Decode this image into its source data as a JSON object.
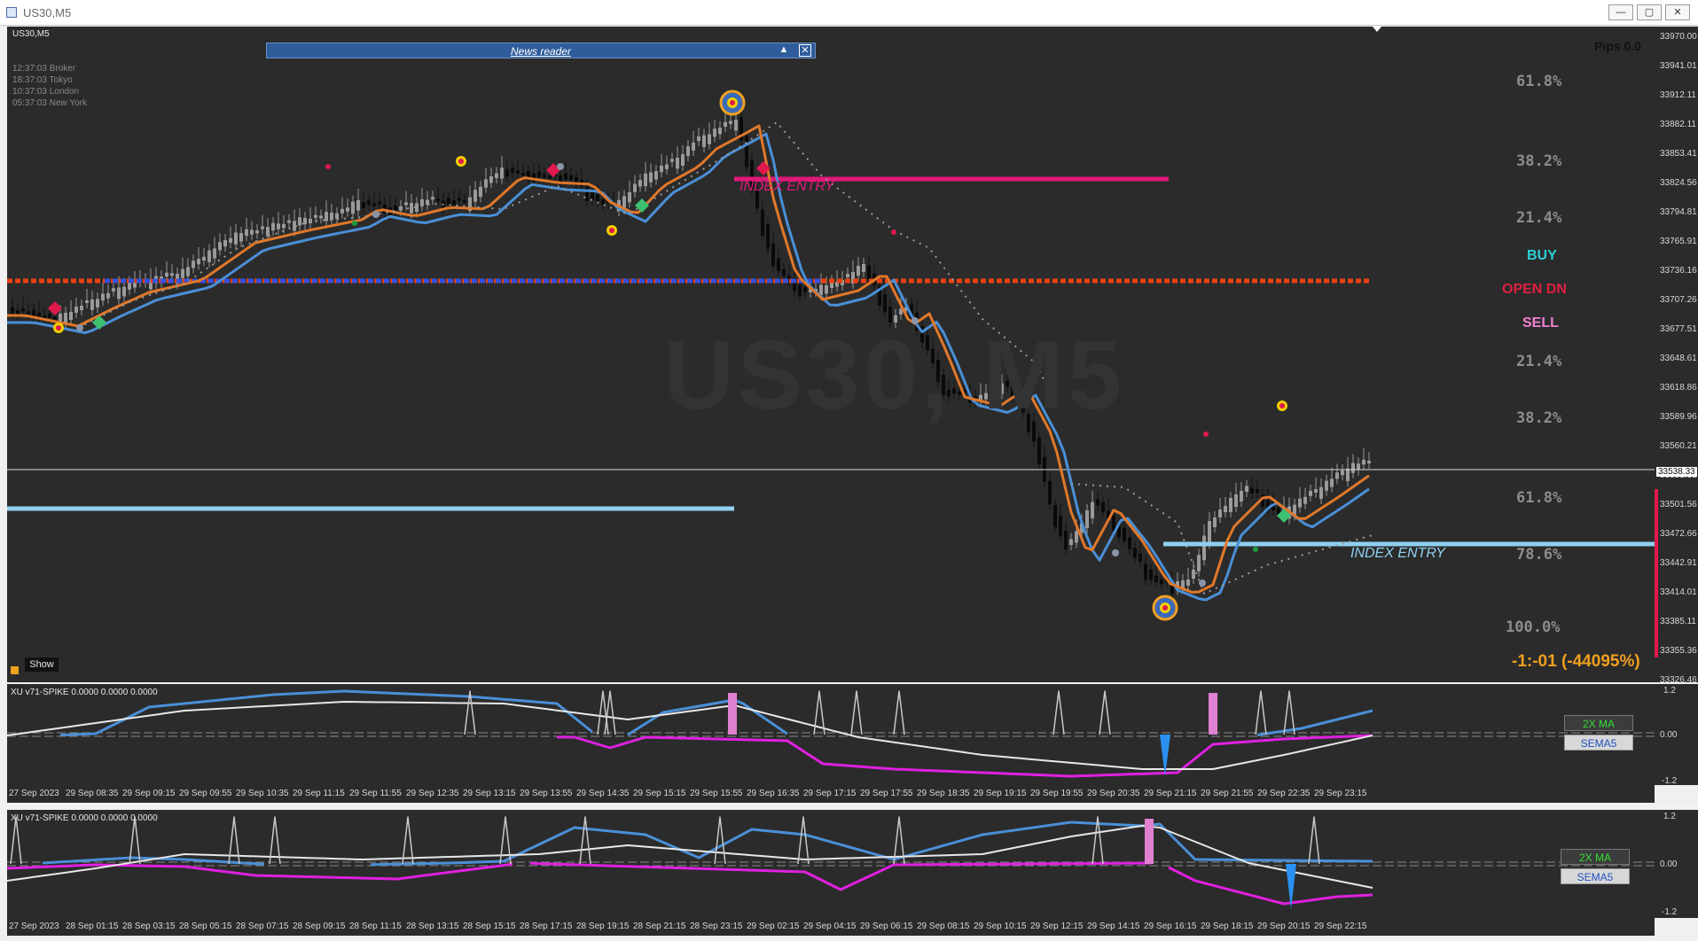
{
  "window": {
    "title": "US30,M5",
    "buttons": [
      "—",
      "▢",
      "✕"
    ]
  },
  "main": {
    "symbol_label": "US30,M5",
    "watermark": "US30, M5",
    "sessions": [
      {
        "time": "12:37:03",
        "name": "Broker"
      },
      {
        "time": "18:37:03",
        "name": "Tokyo"
      },
      {
        "time": "10:37:03",
        "name": "London"
      },
      {
        "time": "05:37:03",
        "name": "New York"
      }
    ],
    "news_reader": {
      "label": "News reader",
      "collapse": "▲",
      "close": "✕"
    },
    "pips": "Pips 0.0",
    "signals": {
      "buy": "BUY",
      "open": "OPEN DN",
      "sell": "SELL"
    },
    "fib_levels": [
      "61.8%",
      "38.2%",
      "21.4%",
      "21.4%",
      "38.2%",
      "61.8%",
      "78.6%",
      "100.0%"
    ],
    "index_entry_1": "INDEX ENTRY",
    "index_entry_2": "INDEX ENTRY",
    "result": "-1:-01 (-44095%)",
    "show_button": "Show",
    "current_price": "33538.33",
    "price_axis": [
      "33970.00",
      "33941.01",
      "33912.11",
      "33882.11",
      "33853.41",
      "33824.56",
      "33794.81",
      "33765.91",
      "33736.16",
      "33707.26",
      "33677.51",
      "33648.61",
      "33618.86",
      "33589.96",
      "33560.21",
      "33531.31",
      "33501.56",
      "33472.66",
      "33442.91",
      "33414.01",
      "33385.11",
      "33355.36",
      "33326.46"
    ]
  },
  "ind1": {
    "label": "XU v71-SPIKE 0.0000 0.0000 0.0000",
    "btn_ma": "2X MA",
    "btn_sema": "SEMA5",
    "axis": [
      "1.2",
      "0.00",
      "-1.2"
    ],
    "time_axis": [
      "27 Sep 2023",
      "29 Sep 08:35",
      "29 Sep 09:15",
      "29 Sep 09:55",
      "29 Sep 10:35",
      "29 Sep 11:15",
      "29 Sep 11:55",
      "29 Sep 12:35",
      "29 Sep 13:15",
      "29 Sep 13:55",
      "29 Sep 14:35",
      "29 Sep 15:15",
      "29 Sep 15:55",
      "29 Sep 16:35",
      "29 Sep 17:15",
      "29 Sep 17:55",
      "29 Sep 18:35",
      "29 Sep 19:15",
      "29 Sep 19:55",
      "29 Sep 20:35",
      "29 Sep 21:15",
      "29 Sep 21:55",
      "29 Sep 22:35",
      "29 Sep 23:15"
    ]
  },
  "ind2": {
    "label": "XU v71-SPIKE 0.0000 0.0000 0.0000",
    "btn_ma": "2X MA",
    "btn_sema": "SEMA5",
    "axis": [
      "1.2",
      "0.00",
      "-1.2"
    ],
    "time_axis": [
      "27 Sep 2023",
      "28 Sep 01:15",
      "28 Sep 03:15",
      "28 Sep 05:15",
      "28 Sep 07:15",
      "28 Sep 09:15",
      "28 Sep 11:15",
      "28 Sep 13:15",
      "28 Sep 15:15",
      "28 Sep 17:15",
      "28 Sep 19:15",
      "28 Sep 21:15",
      "28 Sep 23:15",
      "29 Sep 02:15",
      "29 Sep 04:15",
      "29 Sep 06:15",
      "29 Sep 08:15",
      "29 Sep 10:15",
      "29 Sep 12:15",
      "29 Sep 14:15",
      "29 Sep 16:15",
      "29 Sep 18:15",
      "29 Sep 20:15",
      "29 Sep 22:15"
    ]
  },
  "colors": {
    "background": "#2b2b2b",
    "orange_ma": "#e0782a",
    "blue_ma": "#4a8fd6",
    "magenta": "#e0187a",
    "buy": "#2ad0d8",
    "open": "#e02040",
    "sell": "#f080d0",
    "result": "#f0a020",
    "light_blue": "#8fd0f0",
    "dash_orange": "#f04010",
    "dash_blue": "#3a50e0"
  }
}
